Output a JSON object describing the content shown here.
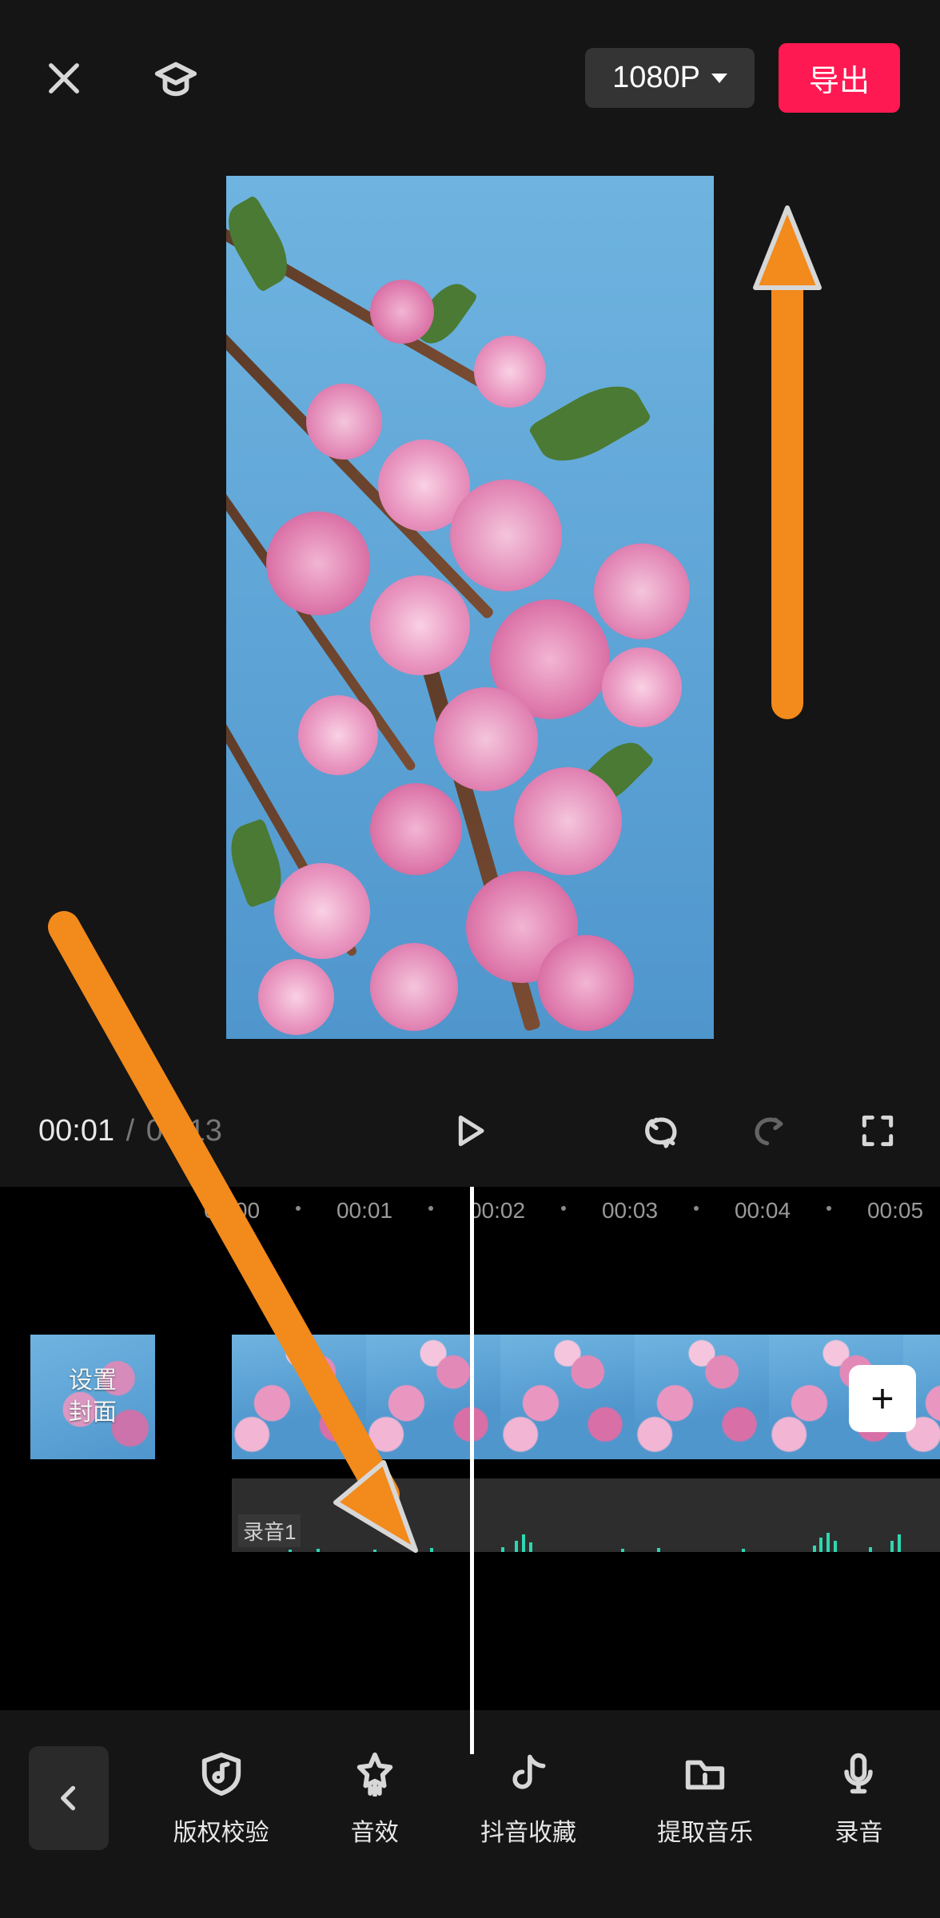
{
  "topbar": {
    "resolution": "1080P",
    "export_label": "导出"
  },
  "playback": {
    "current_time": "00:01",
    "separator": "/",
    "total_time": "00:13"
  },
  "ruler": {
    "ticks": [
      "00:00",
      "00:01",
      "00:02",
      "00:03",
      "00:04",
      "00:05"
    ]
  },
  "cover": {
    "line1": "设置",
    "line2": "封面"
  },
  "audio": {
    "label": "录音1"
  },
  "toolbar": {
    "items": [
      {
        "label": "版权校验",
        "icon": "shield-music-icon"
      },
      {
        "label": "音效",
        "icon": "star-bars-icon"
      },
      {
        "label": "抖音收藏",
        "icon": "douyin-icon"
      },
      {
        "label": "提取音乐",
        "icon": "folder-icon"
      },
      {
        "label": "录音",
        "icon": "microphone-icon"
      }
    ]
  },
  "addclip": {
    "glyph": "+"
  }
}
